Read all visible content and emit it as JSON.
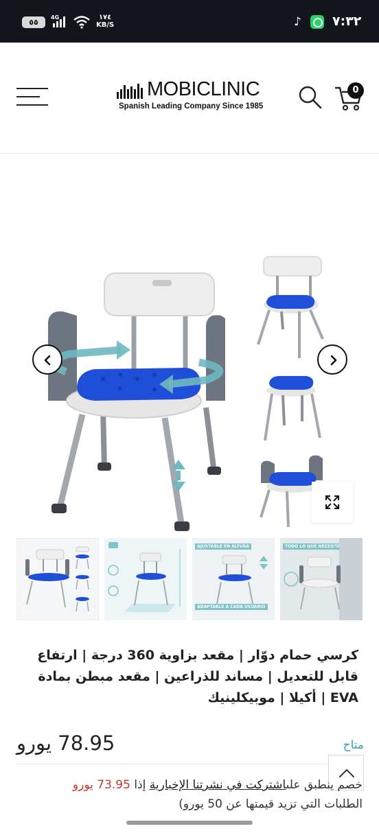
{
  "status_bar": {
    "time": "٧:٣٢",
    "speed_value": "١٧٤",
    "speed_unit": "KB/S",
    "network": "4G",
    "battery": "٥٥"
  },
  "header": {
    "brand": "MOBICLINIC",
    "tagline": "Spanish Leading Company Since 1985",
    "cart_count": "0"
  },
  "gallery": {
    "thumb_labels": [
      "AJUSTABLE EN ALTURA",
      "ADAPTABLE A CADA USUARIO",
      "TODO LO QUE NECESITAS"
    ]
  },
  "product": {
    "title": "كرسي حمام دوّار | مقعد بزاوية 360 درجة | ارتفاع قابل للتعديل | مساند للذراعين | مقعد مبطن بمادة EVA | أكيلا | موبيكلينيك",
    "price": "78.95 يورو",
    "availability": "متاح",
    "promo_prefix": "خصم ينطبق على",
    "promo_link": "اشتركت في نشرتنا الإخبارية",
    "promo_if": "إذا",
    "promo_discount": "73.95 يورو",
    "promo_suffix": "الطلبات التي تزيد قيمتها عن 50 يورو)"
  },
  "colors": {
    "accent": "#3a9eb0",
    "seat_blue": "#1f4fd8",
    "arrow_teal": "#6fb8c0",
    "discount_red": "#c0392b"
  }
}
